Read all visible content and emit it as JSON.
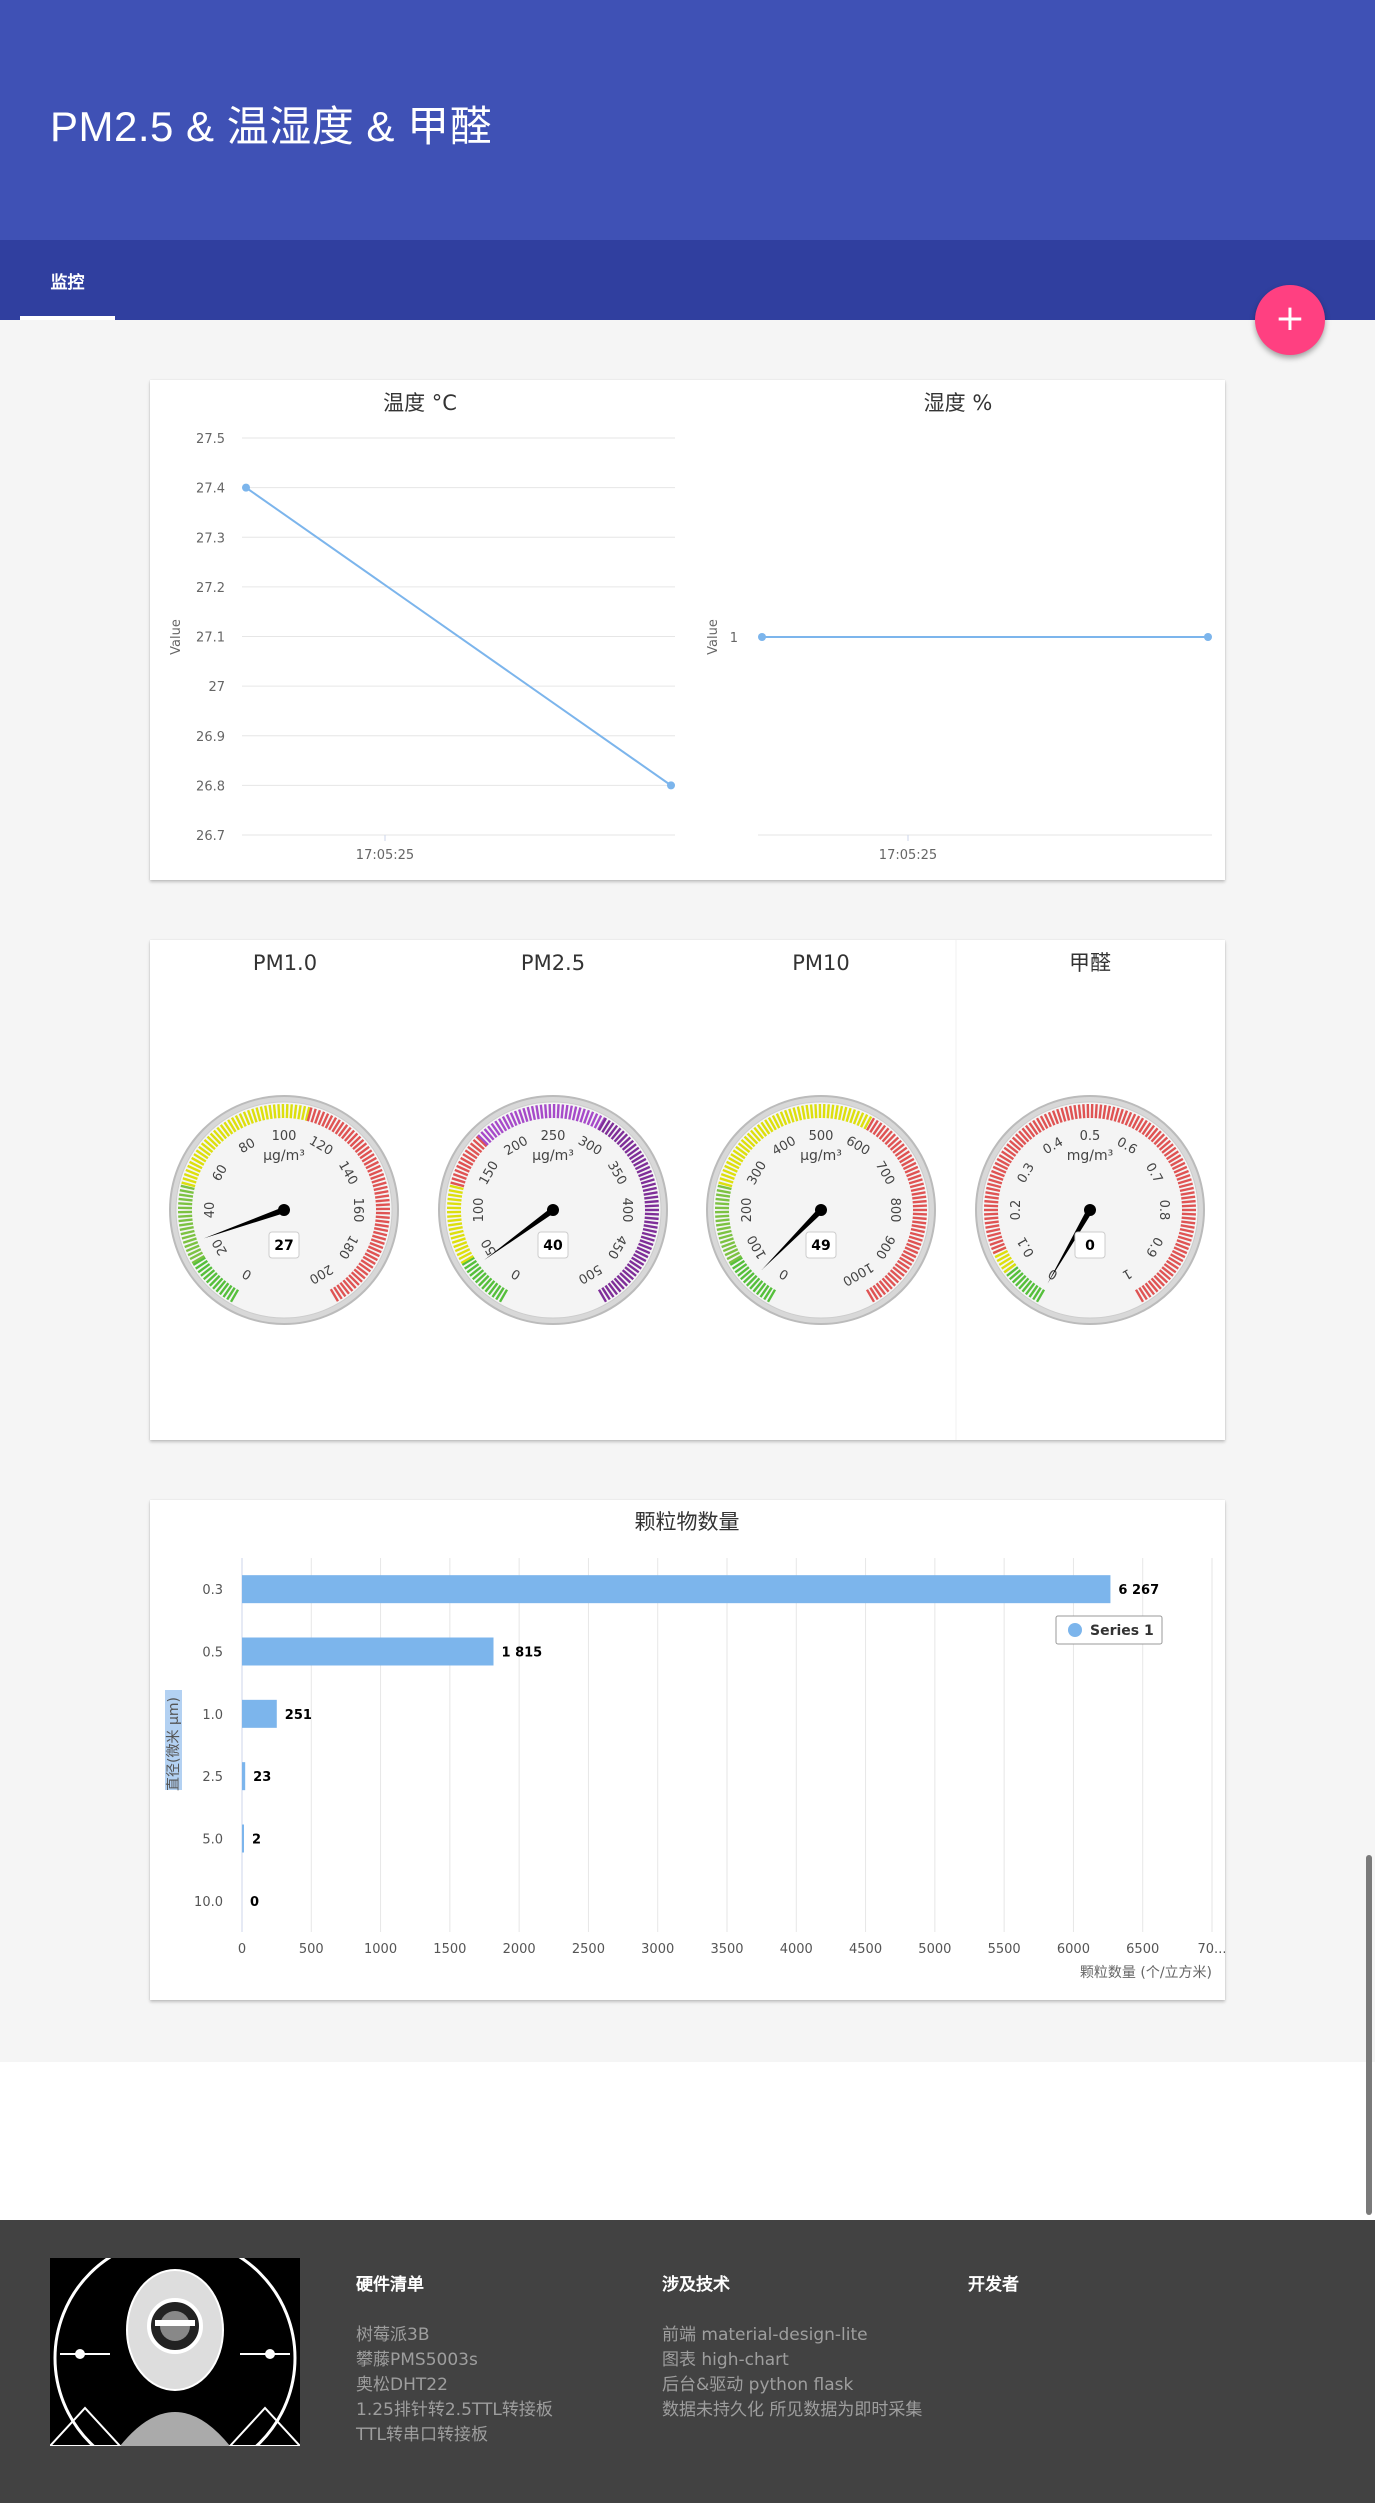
{
  "header": {
    "title": "PM2.5 & 温湿度 & 甲醛"
  },
  "tabs": [
    {
      "label": "监控"
    }
  ],
  "fab": {
    "label": "+"
  },
  "temperature_chart": {
    "title": "温度 °C",
    "ylabel": "Value",
    "xtick": "17:05:25",
    "yticks": [
      "27.5",
      "27.4",
      "27.3",
      "27.2",
      "27.1",
      "27",
      "26.9",
      "26.8",
      "26.7"
    ]
  },
  "humidity_chart": {
    "title": "湿度 %",
    "ylabel": "Value",
    "xtick": "17:05:25",
    "yticks": [
      "1"
    ]
  },
  "gauges": [
    {
      "title": "PM1.0",
      "unit": "μg/m³",
      "value": "27"
    },
    {
      "title": "PM2.5",
      "unit": "μg/m³",
      "value": "40"
    },
    {
      "title": "PM10",
      "unit": "μg/m³",
      "value": "49"
    },
    {
      "title": "甲醛",
      "unit": "mg/m³",
      "value": "0"
    }
  ],
  "particle_chart": {
    "title": "颗粒物数量",
    "ylabel": "直径(微米 μm)",
    "xlabel": "颗粒数量 (个/立方米)",
    "legend": "Series 1",
    "data_labels": [
      "6 267",
      "1 815",
      "251",
      "23",
      "2",
      "0"
    ],
    "xticks": [
      "0",
      "500",
      "1000",
      "1500",
      "2000",
      "2500",
      "3000",
      "3500",
      "4000",
      "4500",
      "5000",
      "5500",
      "6000",
      "6500",
      "70..."
    ]
  },
  "chart_data": [
    {
      "type": "line",
      "title": "温度 °C",
      "ylabel": "Value",
      "x": [
        "",
        ""
      ],
      "series": [
        {
          "values": [
            27.4,
            26.8
          ]
        }
      ],
      "ylim": [
        26.7,
        27.5
      ],
      "grid": true,
      "color": "#7cb5ec"
    },
    {
      "type": "line",
      "title": "湿度 %",
      "ylabel": "Value",
      "x": [
        "",
        ""
      ],
      "series": [
        {
          "values": [
            1,
            1
          ]
        }
      ],
      "grid": false,
      "color": "#7cb5ec"
    },
    {
      "type": "bar",
      "title": "颗粒物数量",
      "xlabel": "颗粒数量 (个/立方米)",
      "ylabel": "直径(微米 μm)",
      "categories": [
        "0.3",
        "0.5",
        "1.0",
        "2.5",
        "5.0",
        "10.0"
      ],
      "series": [
        {
          "name": "Series 1",
          "values": [
            6267,
            1815,
            251,
            23,
            2,
            0
          ]
        }
      ],
      "xlim": [
        0,
        7000
      ],
      "orientation": "horizontal",
      "legend": "top-right",
      "color": "#7cb5ec"
    },
    {
      "type": "gauge",
      "gauges": [
        {
          "title": "PM1.0",
          "value": 27,
          "min": 0,
          "max": 200,
          "ticks": [
            "0",
            "20",
            "40",
            "60",
            "80",
            "100",
            "120",
            "140",
            "160",
            "180",
            "200"
          ]
        },
        {
          "title": "PM2.5",
          "value": 40,
          "min": 0,
          "max": 500,
          "ticks": [
            "0",
            "50",
            "100",
            "150",
            "200",
            "250",
            "300",
            "350",
            "400",
            "450",
            "500"
          ]
        },
        {
          "title": "PM10",
          "value": 49,
          "min": 0,
          "max": 1000,
          "ticks": [
            "0",
            "100",
            "200",
            "300",
            "400",
            "500",
            "600",
            "700",
            "800",
            "900",
            "1000"
          ]
        },
        {
          "title": "甲醛",
          "value": 0,
          "min": 0,
          "max": 1,
          "ticks": [
            "0",
            "0.1",
            "0.2",
            "0.3",
            "0.4",
            "0.5",
            "0.6",
            "0.7",
            "0.8",
            "0.9",
            "1"
          ]
        }
      ]
    }
  ],
  "footer": {
    "columns": [
      {
        "title": "硬件清单",
        "items": [
          "树莓派3B",
          "攀藤PMS5003s",
          "奥松DHT22",
          "1.25排针转2.5TTL转接板",
          "TTL转串口转接板"
        ]
      },
      {
        "title": "涉及技术",
        "items": [
          "前端 material-design-lite",
          "图表 high-chart",
          "后台&驱动 python flask",
          "数据未持久化 所见数据为即时采集"
        ]
      },
      {
        "title": "开发者",
        "items": []
      }
    ]
  },
  "colors": {
    "primary": "#3f51b5",
    "primary_dark": "#303f9f",
    "accent": "#ff4081",
    "series": "#7cb5ec",
    "footer_bg": "#424242"
  }
}
